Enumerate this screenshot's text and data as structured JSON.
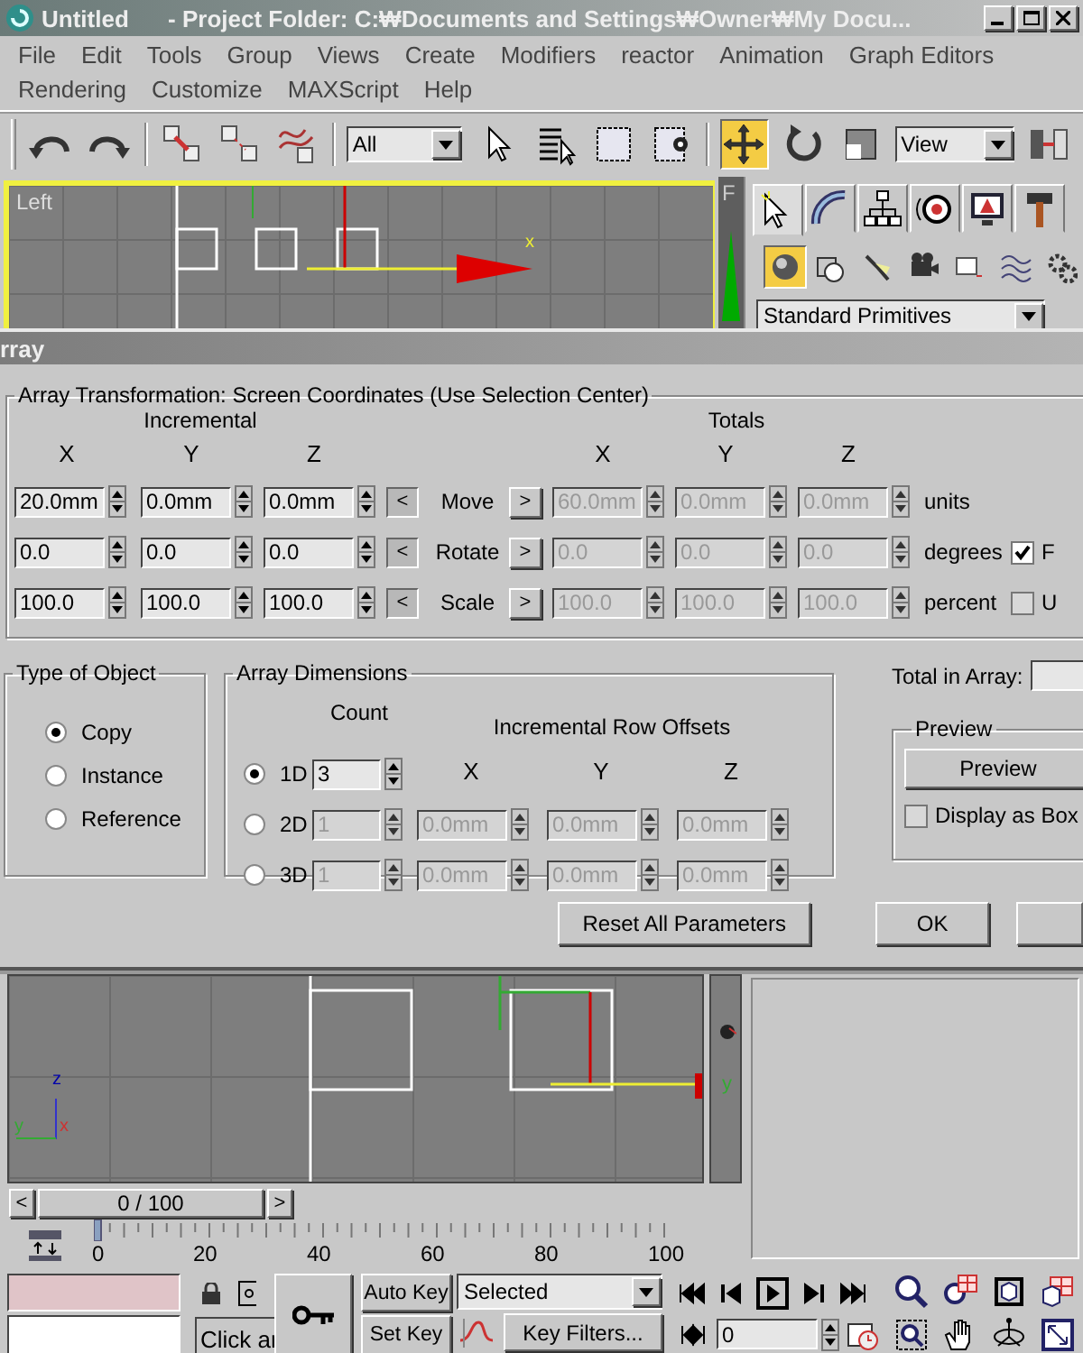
{
  "window": {
    "title": "Untitled      - Project Folder: C:₩Documents and Settings₩Owner₩My Docu..."
  },
  "menu_rows": [
    [
      "File",
      "Edit",
      "Tools",
      "Group",
      "Views",
      "Create",
      "Modifiers",
      "reactor",
      "Animation",
      "Graph Editors"
    ],
    [
      "Rendering",
      "Customize",
      "MAXScript",
      "Help"
    ]
  ],
  "toolbar": {
    "selection_filter": "All",
    "reference_coordinate": "View",
    "transform_tools": [
      {
        "kind": "move",
        "selected": true
      },
      {
        "kind": "rotate",
        "selected": false
      },
      {
        "kind": "scale",
        "selected": false
      }
    ]
  },
  "top_viewport": {
    "label": "Left",
    "gizmo_label": "x",
    "side_label": "F"
  },
  "command_panel": {
    "tabs": [
      {
        "selected": true
      },
      {
        "selected": false
      },
      {
        "selected": false
      },
      {
        "selected": false
      },
      {
        "selected": false
      },
      {
        "selected": false
      }
    ],
    "categories": [
      {
        "selected": true
      },
      {
        "selected": false
      },
      {
        "selected": false
      },
      {
        "selected": false
      },
      {
        "selected": false
      },
      {
        "selected": false
      },
      {
        "selected": false
      }
    ],
    "object_type": "Standard Primitives"
  },
  "dialog": {
    "title": "rray",
    "transformation": {
      "legend": "Array Transformation: Screen Coordinates (Use Selection Center)",
      "incremental_label": "Incremental",
      "totals_label": "Totals",
      "incremental_axes": [
        "X",
        "Y",
        "Z"
      ],
      "totals_axes": [
        "X",
        "Y",
        "Z"
      ],
      "totals_disabled": true,
      "rows": [
        {
          "name": "Move",
          "incremental": [
            "20.0mm",
            "0.0mm",
            "0.0mm"
          ],
          "totals": [
            "60.0mm",
            "0.0mm",
            "0.0mm"
          ],
          "unit": "units",
          "left": "<",
          "right": ">",
          "incremental_active": true
        },
        {
          "name": "Rotate",
          "incremental": [
            "0.0",
            "0.0",
            "0.0"
          ],
          "totals": [
            "0.0",
            "0.0",
            "0.0"
          ],
          "unit": "degrees",
          "left": "<",
          "right": ">",
          "incremental_active": true
        },
        {
          "name": "Scale",
          "incremental": [
            "100.0",
            "100.0",
            "100.0"
          ],
          "totals": [
            "100.0",
            "100.0",
            "100.0"
          ],
          "unit": "percent",
          "left": "<",
          "right": ">",
          "incremental_active": true
        }
      ],
      "options": [
        {
          "label": "F",
          "checked": true
        },
        {
          "label": "U",
          "checked": false
        }
      ]
    },
    "type_of_object": {
      "legend": "Type of Object",
      "options": [
        {
          "label": "Copy",
          "selected": true
        },
        {
          "label": "Instance",
          "selected": false
        },
        {
          "label": "Reference",
          "selected": false
        }
      ]
    },
    "array_dimensions": {
      "legend": "Array Dimensions",
      "count_label": "Count",
      "offsets_label": "Incremental Row Offsets",
      "axes": [
        "X",
        "Y",
        "Z"
      ],
      "rows": [
        {
          "label": "1D",
          "selected": true,
          "count": "3",
          "disabled": false
        },
        {
          "label": "2D",
          "selected": false,
          "count": "1",
          "disabled": true,
          "offsets": [
            "0.0mm",
            "0.0mm",
            "0.0mm"
          ]
        },
        {
          "label": "3D",
          "selected": false,
          "count": "1",
          "disabled": true,
          "offsets": [
            "0.0mm",
            "0.0mm",
            "0.0mm"
          ]
        }
      ]
    },
    "total_in_array_label": "Total in Array:",
    "preview": {
      "legend": "Preview",
      "button": "Preview",
      "display_as_box": {
        "label": "Display as Box",
        "checked": false
      }
    },
    "buttons": [
      "Reset All Parameters",
      "OK"
    ]
  },
  "bottom_viewport": {
    "axis_labels": [
      "z",
      "y",
      "x"
    ],
    "side_label": "y"
  },
  "time_slider": {
    "position": "0 / 100",
    "prev": "<",
    "next": ">"
  },
  "track_bar": {
    "ticks": [
      "0",
      "20",
      "40",
      "60",
      "80",
      "100"
    ]
  },
  "status": {
    "prompt": "Click ar",
    "auto_key": "Auto Key",
    "set_key": "Set Key",
    "key_set": "Selected",
    "key_filters": "Key Filters...",
    "frame": "0"
  }
}
